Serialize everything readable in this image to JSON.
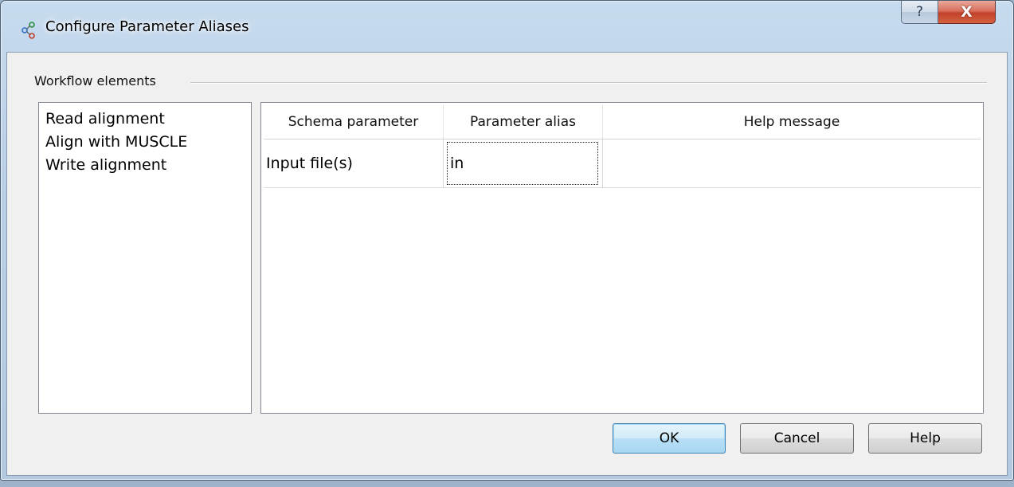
{
  "window": {
    "title": "Configure Parameter Aliases",
    "icon": "workflow-icon",
    "caption_buttons": {
      "help": "?",
      "close": "X"
    }
  },
  "group": {
    "label": "Workflow elements"
  },
  "elements": [
    {
      "label": "Read alignment"
    },
    {
      "label": "Align with MUSCLE"
    },
    {
      "label": "Write alignment"
    }
  ],
  "table": {
    "headers": [
      "Schema parameter",
      "Parameter alias",
      "Help message"
    ],
    "rows": [
      {
        "schema_parameter": "Input file(s)",
        "parameter_alias": "in",
        "help_message": ""
      }
    ]
  },
  "buttons": {
    "ok": "OK",
    "cancel": "Cancel",
    "help": "Help"
  },
  "colors": {
    "ok_button_border": "#3c7fb1",
    "close_button": "#c2412b"
  }
}
